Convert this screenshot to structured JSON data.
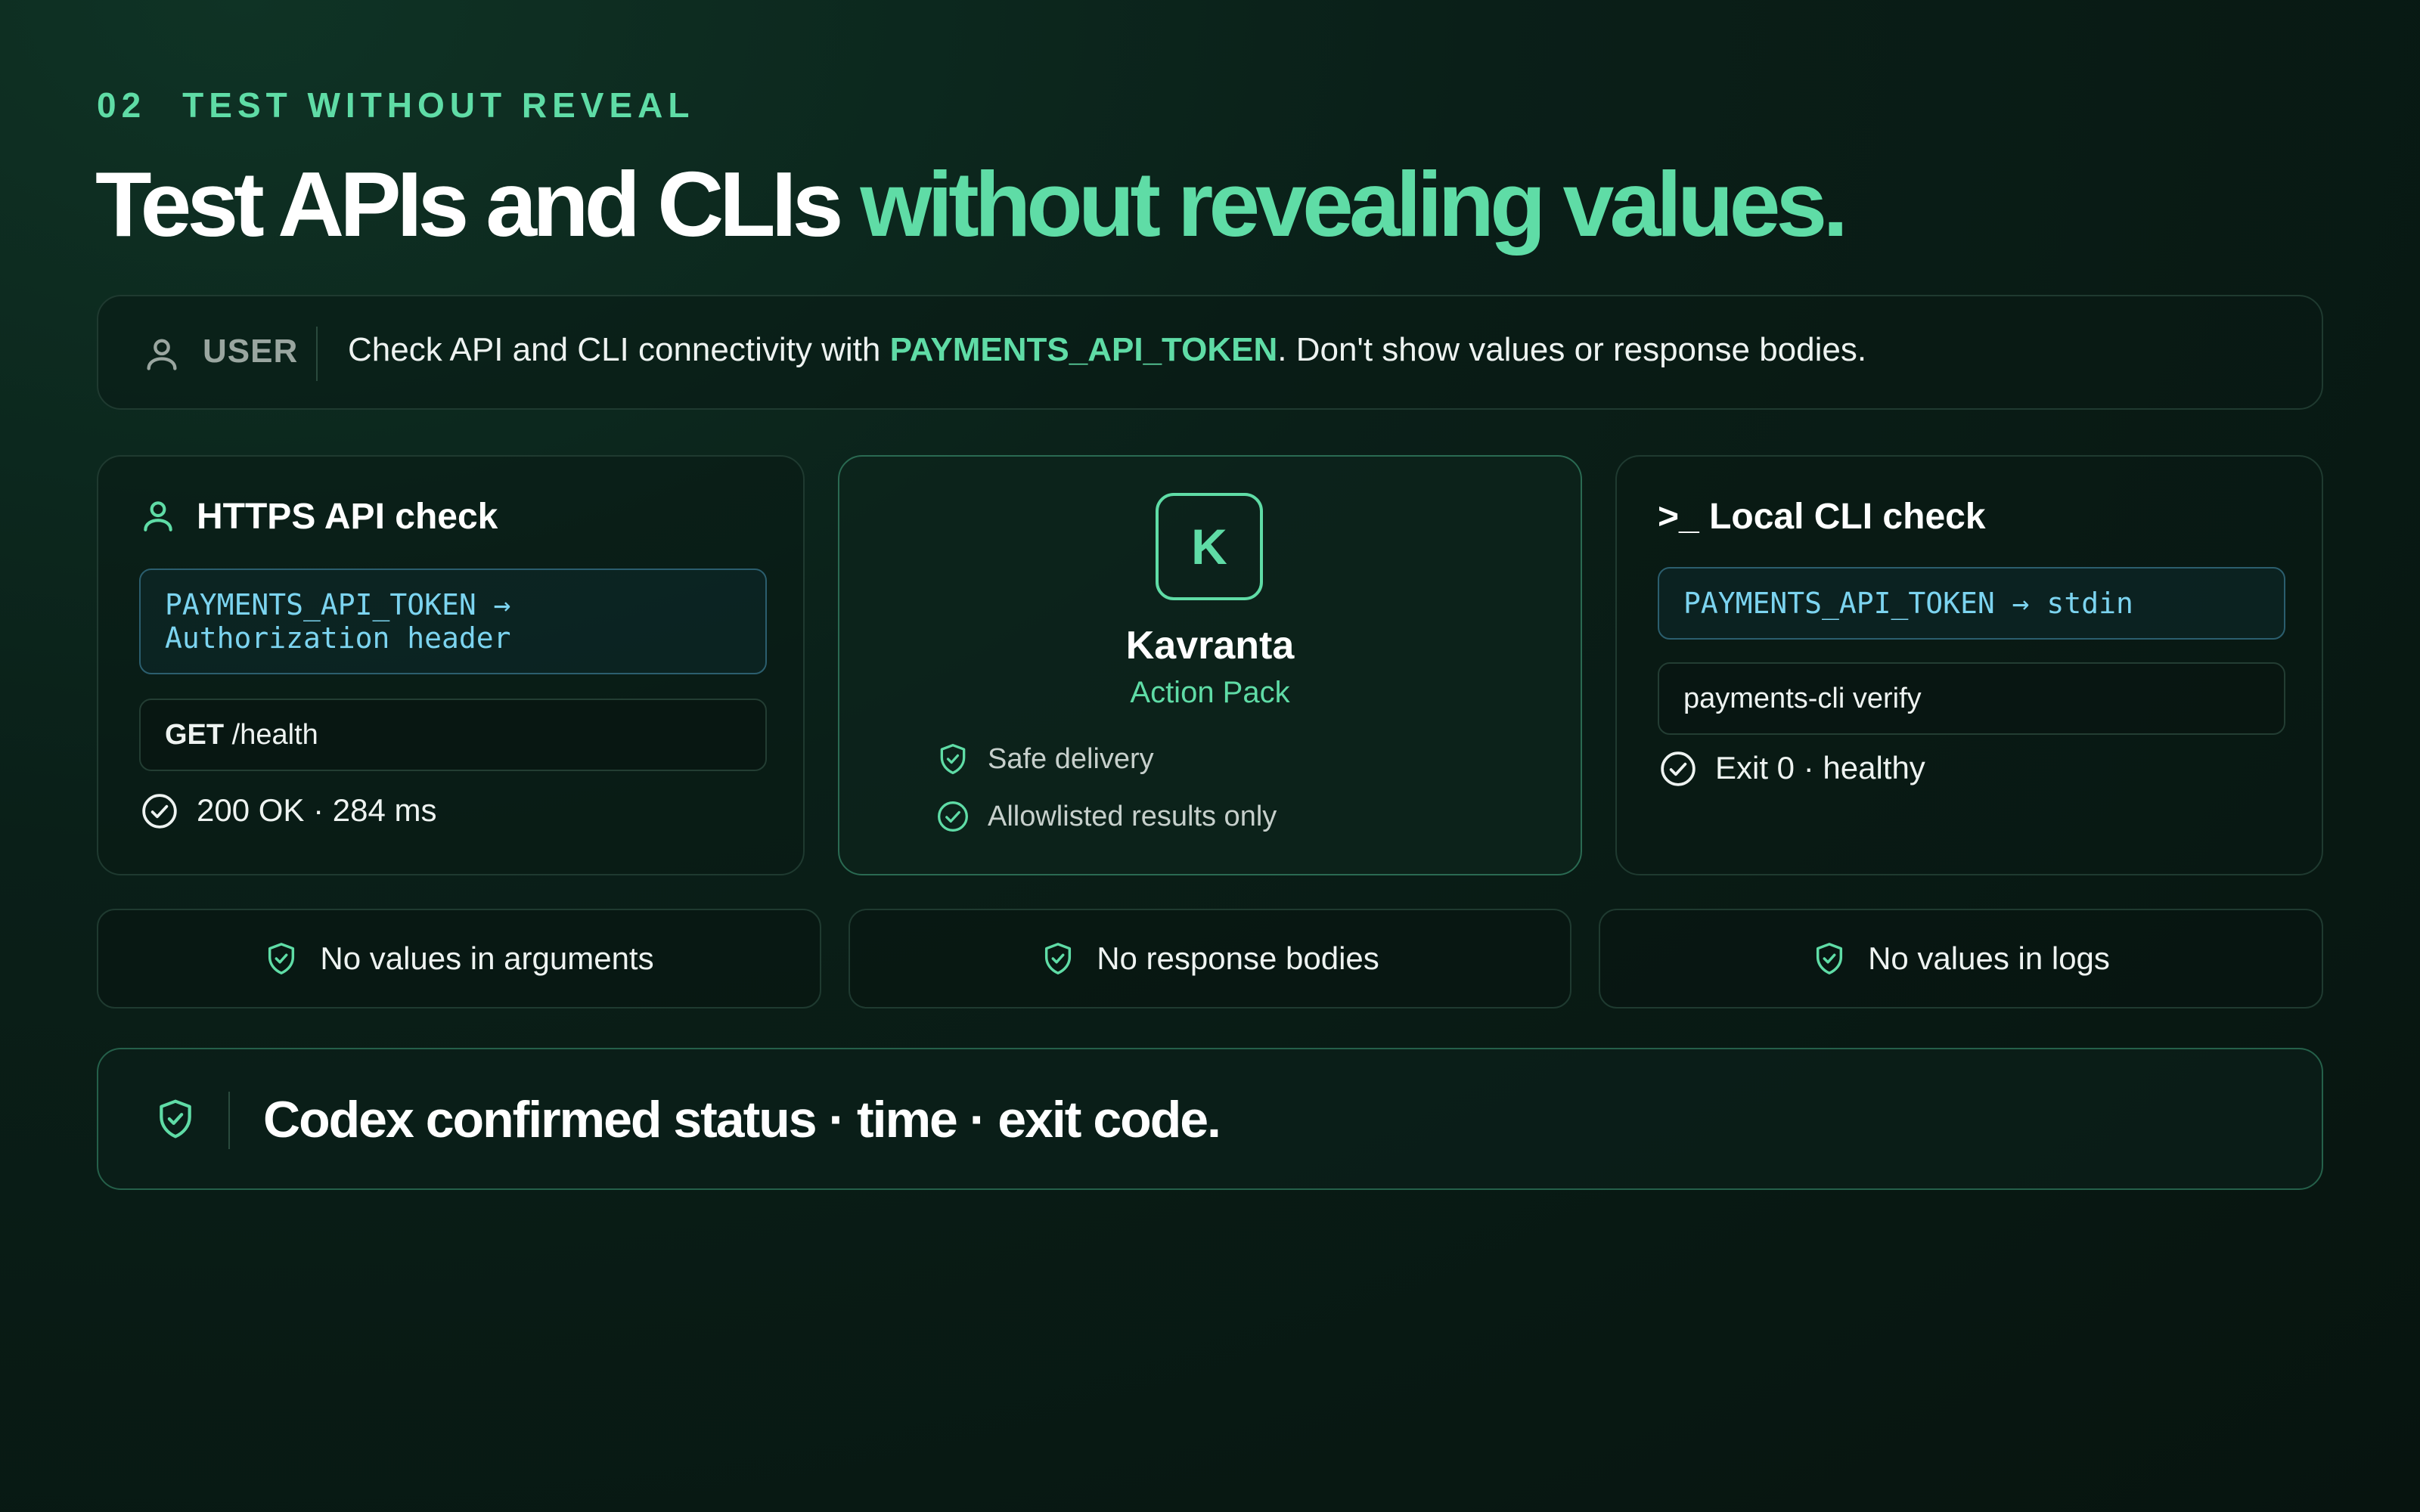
{
  "eyebrow": {
    "number": "02",
    "label": "TEST WITHOUT REVEAL"
  },
  "headline": {
    "main": "Test APIs and CLIs ",
    "accent": "without revealing values."
  },
  "user_prompt": {
    "role_label": "USER",
    "message_before": "Check API and CLI connectivity with ",
    "token": "PAYMENTS_API_TOKEN",
    "message_after": ". Don't show values or response bodies."
  },
  "api_check": {
    "title": "HTTPS API check",
    "mapping_line1": "PAYMENTS_API_TOKEN →",
    "mapping_line2": "Authorization header",
    "method": "GET",
    "path": " /health",
    "result": "200 OK · 284 ms"
  },
  "brand_card": {
    "logo_letter": "K",
    "name": "Kavranta",
    "subtitle": "Action Pack",
    "features": [
      "Safe delivery",
      "Allowlisted results only"
    ]
  },
  "cli_check": {
    "title": ">_ Local CLI check",
    "mapping": "PAYMENTS_API_TOKEN → stdin",
    "command": "payments-cli verify",
    "result": "Exit 0 · healthy"
  },
  "guarantees": [
    "No values in arguments",
    "No response bodies",
    "No values in logs"
  ],
  "confirmation": "Codex confirmed status · time · exit code.",
  "colors": {
    "accent": "#5fdca6",
    "mono": "#7cd4f0",
    "background": "#07140f"
  },
  "icons": {
    "user": "person-icon",
    "check": "check-circle-icon",
    "shield": "shield-check-icon"
  }
}
